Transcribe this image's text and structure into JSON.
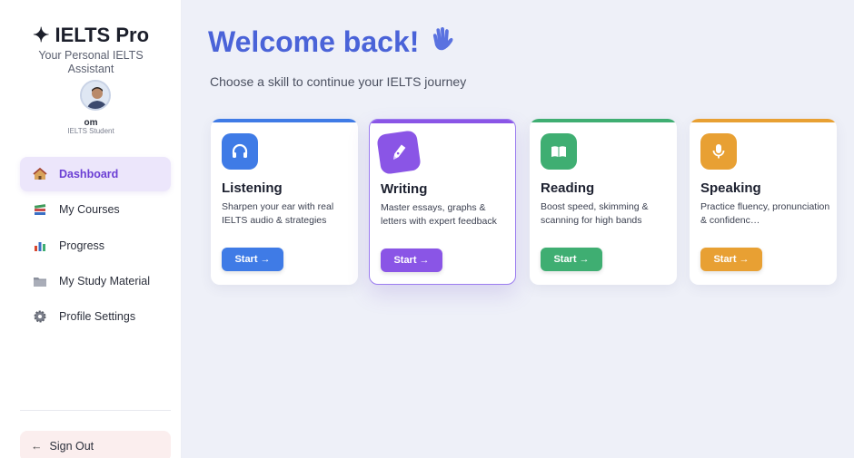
{
  "sidebar": {
    "brand": "✦ IELTS Pro",
    "subtitle": "Your Personal IELTS Assistant",
    "user": {
      "name": "om",
      "role": "IELTS Student"
    },
    "nav": [
      {
        "label": "Dashboard",
        "icon": "house-icon",
        "active": true
      },
      {
        "label": "My Courses",
        "icon": "books-icon"
      },
      {
        "label": "Progress",
        "icon": "bar-chart-icon"
      },
      {
        "label": "My Study Material",
        "icon": "folder-icon"
      },
      {
        "label": "Profile Settings",
        "icon": "gear-icon"
      }
    ],
    "signout": {
      "arrow": "←",
      "label": "Sign Out"
    }
  },
  "main": {
    "title": "Welcome back!",
    "subtitle": "Choose a skill to continue your IELTS journey",
    "cards": [
      {
        "title": "Listening",
        "desc": "Sharpen your ear with real IELTS audio & strategies",
        "button": "Start →",
        "color": "#3f7be6",
        "icon": "headphones-icon"
      },
      {
        "title": "Writing",
        "desc": "Master essays, graphs & letters with expert feedback",
        "button": "Start →",
        "color": "#8a55e6",
        "icon": "pen-icon"
      },
      {
        "title": "Reading",
        "desc": "Boost speed, skimming & scanning for high bands",
        "button": "Start →",
        "color": "#3fae72",
        "icon": "book-icon"
      },
      {
        "title": "Speaking",
        "desc": "Practice fluency, pronunciation & confidenc…",
        "button": "Start →",
        "color": "#e8a033",
        "icon": "microphone-icon"
      }
    ]
  }
}
